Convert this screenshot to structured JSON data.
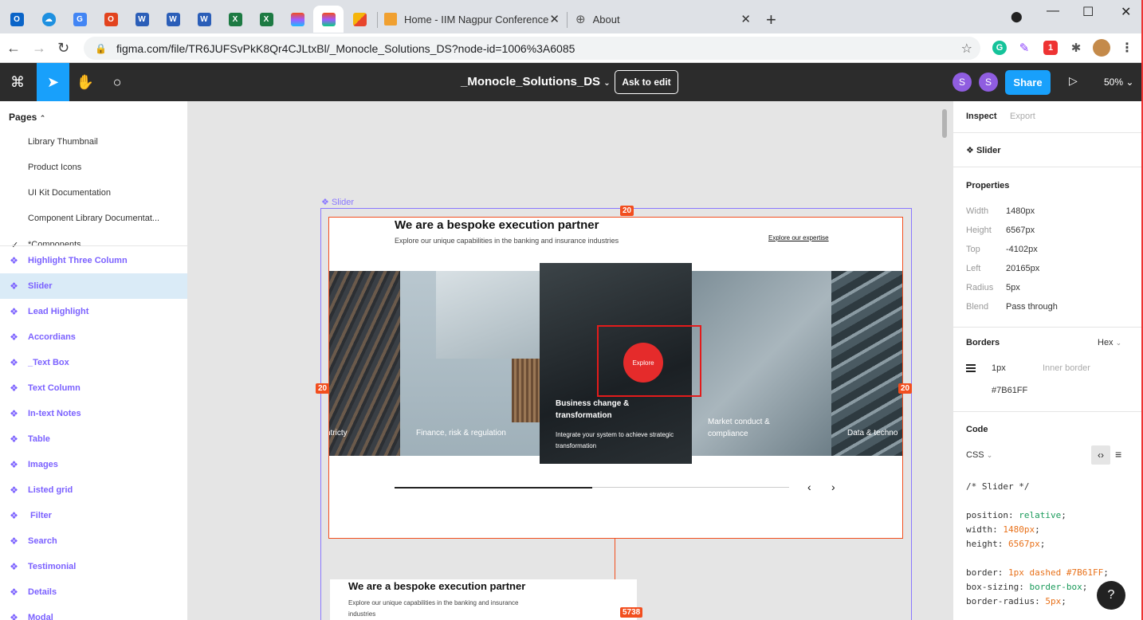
{
  "browser": {
    "tabs": [
      {
        "label": "Home - IIM Nagpur Conference",
        "icon": "conference-favicon"
      },
      {
        "label": "About",
        "icon": "globe-icon"
      }
    ],
    "url": "figma.com/file/TR6JUFSvPkK8Qr4CJLtxBl/_Monocle_Solutions_DS?node-id=1006%3A6085"
  },
  "figma_toolbar": {
    "filename": "_Monocle_Solutions_DS",
    "ask_to_edit": "Ask to edit",
    "avatars": [
      "S",
      "S"
    ],
    "share": "Share",
    "zoom": "50%"
  },
  "left_panel": {
    "pages_header": "Pages",
    "pages": [
      "Library Thumbnail",
      "Product Icons",
      "UI Kit Documentation",
      "Component Library Documentat...",
      "*Components"
    ],
    "layers": [
      "Highlight Three Column",
      "Slider",
      "Lead Highlight",
      "Accordians",
      "_Text Box",
      "Text Column",
      "In-text Notes",
      "Table",
      "Images",
      "Listed grid",
      " Filter",
      "Search",
      "Testimonial",
      "Details",
      "Modal"
    ]
  },
  "canvas": {
    "frame_label": "Slider",
    "measure_top": "20",
    "measure_left": "20",
    "measure_right": "20",
    "measure_bottom": "5738",
    "slide_title": "We are a bespoke execution partner",
    "slide_subtitle": "Explore our unique capabilities in the banking and insurance industries",
    "slide_link": "Explore our expertise",
    "card1_label": "ntricty",
    "card2_label": "Finance, risk & regulation",
    "card3_title": "Business change & transformation",
    "card3_body": "Integrate your system to achieve strategic transformation",
    "explore": "Explore",
    "card4_label": "Market conduct & compliance",
    "card5_label": "Data & techno",
    "progress_fraction": 0.5,
    "frame2_title": "We are a bespoke execution partner",
    "frame2_subtitle": "Explore our unique capabilities in the banking and insurance industries"
  },
  "right_panel": {
    "tab_inspect": "Inspect",
    "tab_export": "Export",
    "component_name": "Slider",
    "properties_header": "Properties",
    "properties": [
      {
        "k": "Width",
        "v": "1480px"
      },
      {
        "k": "Height",
        "v": "6567px"
      },
      {
        "k": "Top",
        "v": "-4102px"
      },
      {
        "k": "Left",
        "v": "20165px"
      },
      {
        "k": "Radius",
        "v": "5px"
      },
      {
        "k": "Blend",
        "v": "Pass through"
      }
    ],
    "borders_header": "Borders",
    "borders_format": "Hex",
    "border_width": "1px",
    "border_type": "Inner border",
    "border_color": "#7B61FF",
    "code_header": "Code",
    "code_lang": "CSS",
    "code_comment": "/* Slider */",
    "code_lines": [
      {
        "prop": "position: ",
        "val": "relative",
        "kind": "kv"
      },
      {
        "prop": "width: ",
        "val": "1480px",
        "kind": "nv"
      },
      {
        "prop": "height: ",
        "val": "6567px",
        "kind": "nv"
      },
      {
        "prop": "border: ",
        "val": "1px dashed #7B61FF",
        "kind": "mix"
      },
      {
        "prop": "box-sizing: ",
        "val": "border-box",
        "kind": "kv"
      },
      {
        "prop": "border-radius: ",
        "val": "5px",
        "kind": "nv"
      }
    ],
    "help": "?"
  },
  "colors": {
    "figma_blue": "#18a0fb",
    "component_purple": "#7b61ff",
    "measure_red": "#f24e1e",
    "explore_red": "#e52b2b"
  }
}
